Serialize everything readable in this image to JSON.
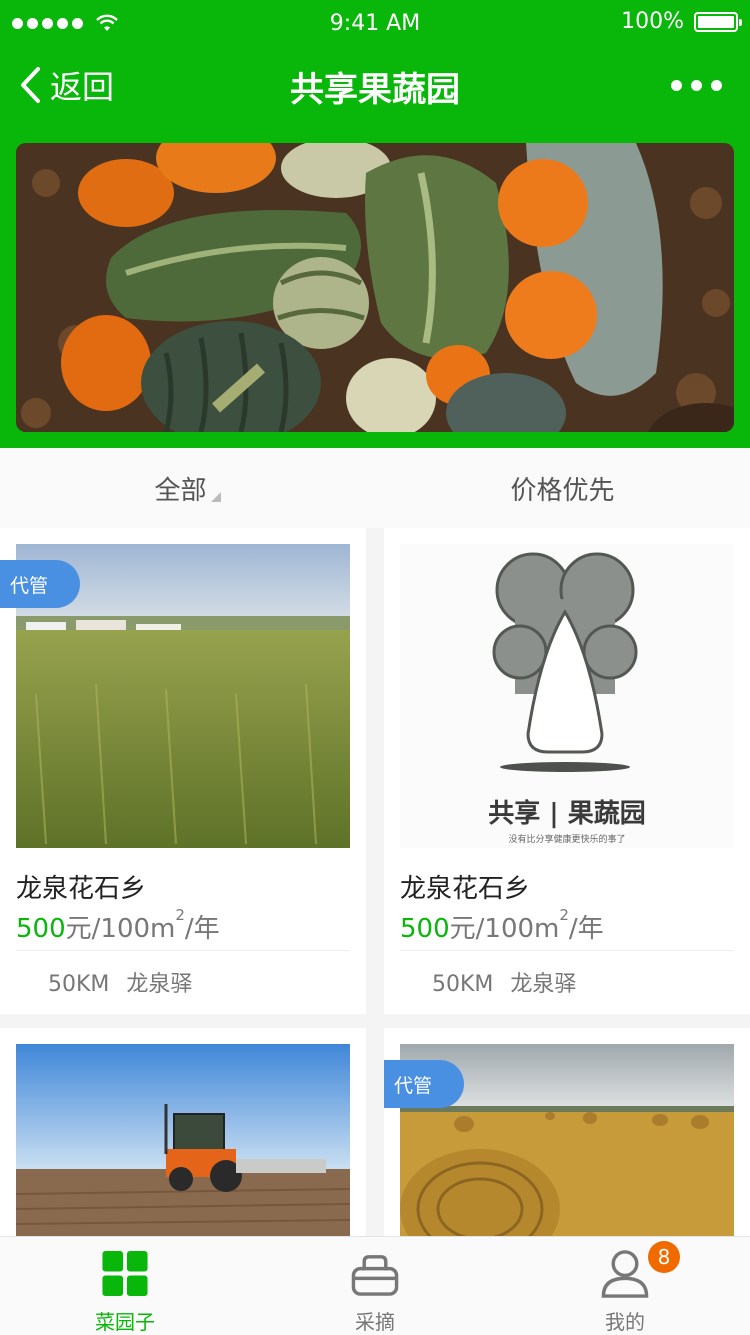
{
  "status_bar": {
    "time": "9:41 AM",
    "battery": "100%"
  },
  "nav": {
    "back_label": "返回",
    "title": "共享果蔬园"
  },
  "filter": {
    "all_label": "全部",
    "price_label": "价格优先"
  },
  "cards": [
    {
      "tag": "代管",
      "name": "龙泉花石乡",
      "price_num": "500",
      "price_unit": "元/100m",
      "price_sup": "2",
      "price_tail": "/年",
      "distance": "50KM",
      "location": "龙泉驿"
    },
    {
      "name": "龙泉花石乡",
      "price_num": "500",
      "price_unit": "元/100m",
      "price_sup": "2",
      "price_tail": "/年",
      "distance": "50KM",
      "location": "龙泉驿",
      "logo_text": "共享 | 果蔬园",
      "logo_slogan": "没有比分享健康更快乐的事了"
    },
    {},
    {
      "tag": "代管"
    }
  ],
  "tabbar": [
    {
      "label": "菜园子",
      "icon": "grid-icon",
      "active": true
    },
    {
      "label": "采摘",
      "icon": "basket-icon"
    },
    {
      "label": "我的",
      "icon": "user-icon",
      "badge": "8"
    }
  ],
  "colors": {
    "brand_green": "#09b60a",
    "tag_blue": "#4a90e2",
    "badge_orange": "#f06a00"
  }
}
